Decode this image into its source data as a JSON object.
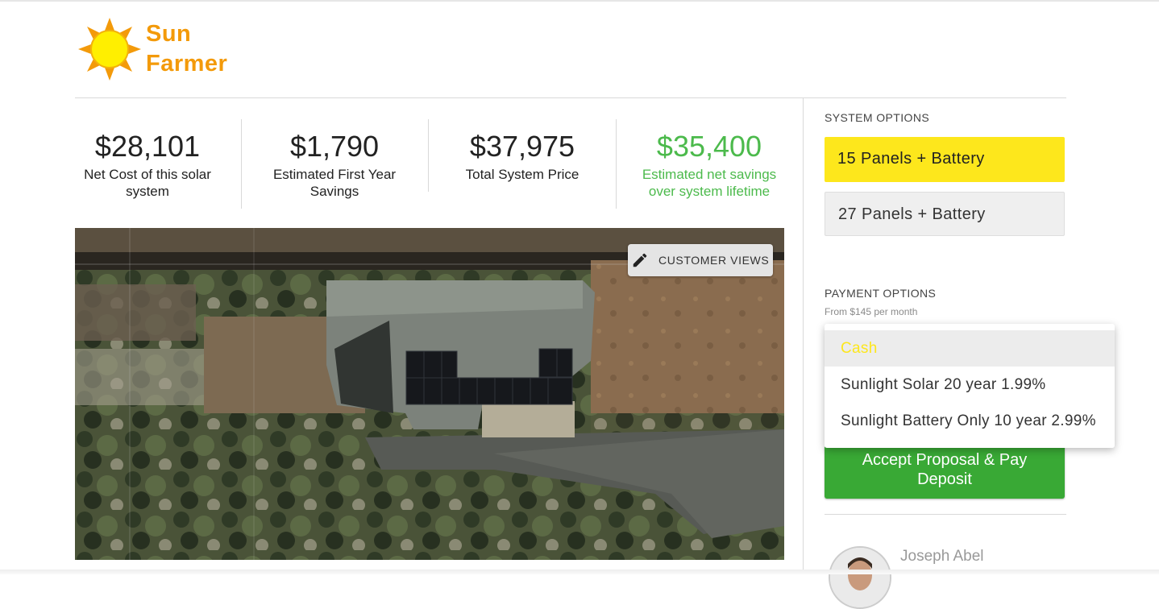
{
  "brand": {
    "line1": "Sun",
    "line2": "Farmer",
    "sun_color": "#ffef00",
    "ray_color": "#f39a0a"
  },
  "stats": [
    {
      "value": "$28,101",
      "label": "Net Cost of this solar system"
    },
    {
      "value": "$1,790",
      "label": "Estimated First Year Savings"
    },
    {
      "value": "$37,975",
      "label": "Total System Price"
    },
    {
      "value": "$35,400",
      "label": "Estimated net savings over system lifetime",
      "color": "#4cba4c"
    }
  ],
  "map": {
    "customer_views_label": "CUSTOMER VIEWS",
    "edit_icon": "pencil-icon"
  },
  "system_options": {
    "title": "SYSTEM OPTIONS",
    "items": [
      {
        "label": "15 Panels + Battery",
        "selected": true
      },
      {
        "label": "27 Panels + Battery",
        "selected": false
      }
    ]
  },
  "payment_options": {
    "title": "PAYMENT OPTIONS",
    "subtitle": "From $145 per month",
    "options": [
      {
        "label": "Cash",
        "selected": true
      },
      {
        "label": "Sunlight Solar 20 year 1.99%"
      },
      {
        "label": "Sunlight Battery Only 10 year 2.99%"
      }
    ]
  },
  "accept_button": {
    "line1": "Accept Proposal & Pay",
    "line2": "Deposit"
  },
  "rep": {
    "name": "Joseph Abel"
  },
  "colors": {
    "accent_yellow": "#fde71c",
    "accept_green": "#39a935",
    "savings_green": "#4cba4c"
  }
}
